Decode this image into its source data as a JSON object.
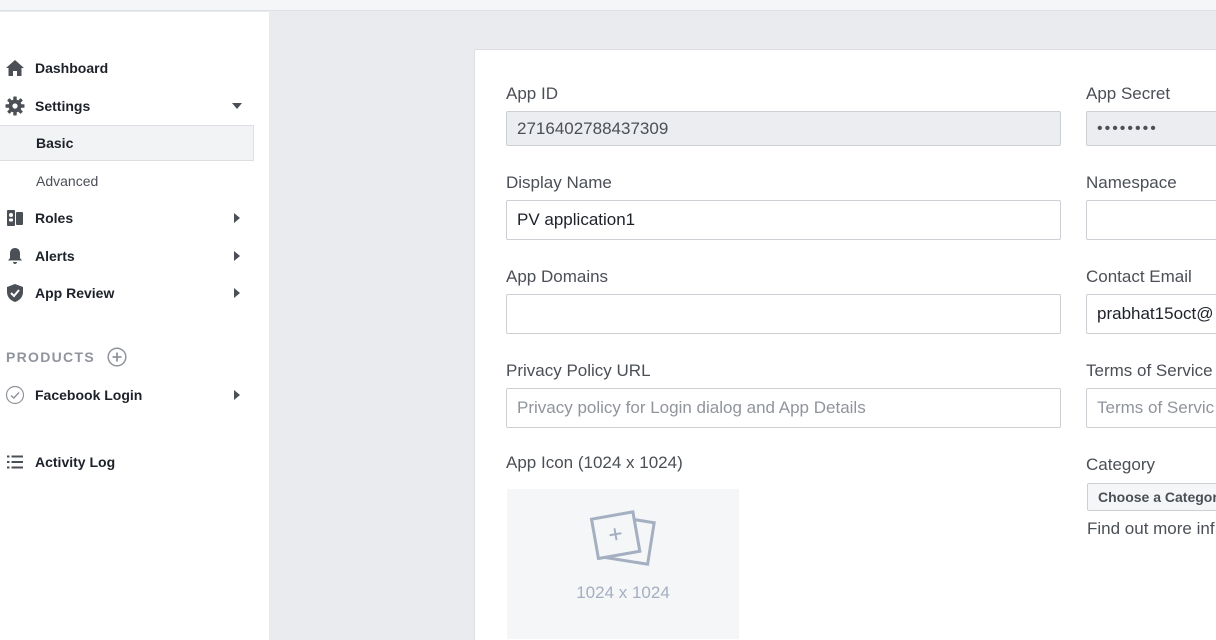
{
  "sidebar": {
    "dashboard": "Dashboard",
    "settings": "Settings",
    "basic": "Basic",
    "advanced": "Advanced",
    "roles": "Roles",
    "alerts": "Alerts",
    "app_review": "App Review",
    "products_header": "PRODUCTS",
    "facebook_login": "Facebook Login",
    "activity_log": "Activity Log"
  },
  "form": {
    "app_id_label": "App ID",
    "app_id_value": "2716402788437309",
    "app_secret_label": "App Secret",
    "app_secret_value": "••••••••",
    "display_name_label": "Display Name",
    "display_name_value": "PV application1",
    "namespace_label": "Namespace",
    "namespace_value": "",
    "app_domains_label": "App Domains",
    "app_domains_value": "",
    "contact_email_label": "Contact Email",
    "contact_email_value": "prabhat15oct@",
    "privacy_policy_label": "Privacy Policy URL",
    "privacy_policy_placeholder": "Privacy policy for Login dialog and App Details",
    "terms_label": "Terms of Service",
    "terms_placeholder": "Terms of Servic",
    "app_icon_label": "App Icon (1024 x 1024)",
    "app_icon_size": "1024 x 1024",
    "category_label": "Category",
    "category_button": "Choose a Categor",
    "find_more": "Find out more inf"
  },
  "colors": {
    "background": "#e9ebee",
    "sidebar": "#ffffff",
    "text": "#1d2129",
    "muted": "#90949c"
  }
}
